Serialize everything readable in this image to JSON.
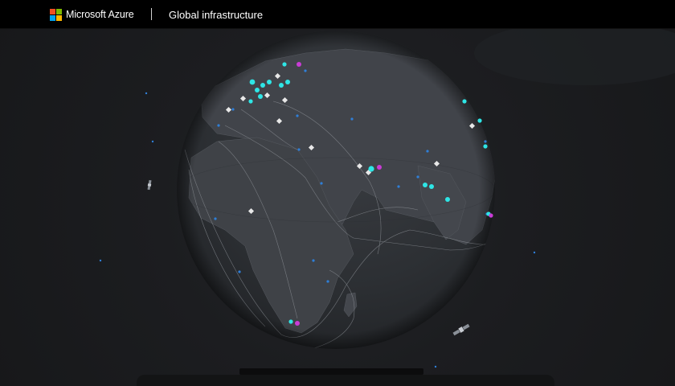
{
  "header": {
    "brand_name": "Microsoft Azure",
    "section_title": "Global infrastructure",
    "logo_colors": [
      "#f25022",
      "#7fba00",
      "#00a4ef",
      "#ffb900"
    ]
  },
  "colors": {
    "background": "#1a1b1d",
    "globe_ocean": "#2c2f33",
    "globe_land": "#3f4246",
    "region_available": "#2ee6e6",
    "region_announced": "#c93cd6",
    "datacenter_marker": "#e8e8e8",
    "network_point": "#2f7fd8"
  },
  "map_markers": {
    "icons": [
      "region-available-icon",
      "region-announced-icon",
      "datacenter-marker-icon",
      "network-pop-icon",
      "satellite-icon"
    ]
  }
}
